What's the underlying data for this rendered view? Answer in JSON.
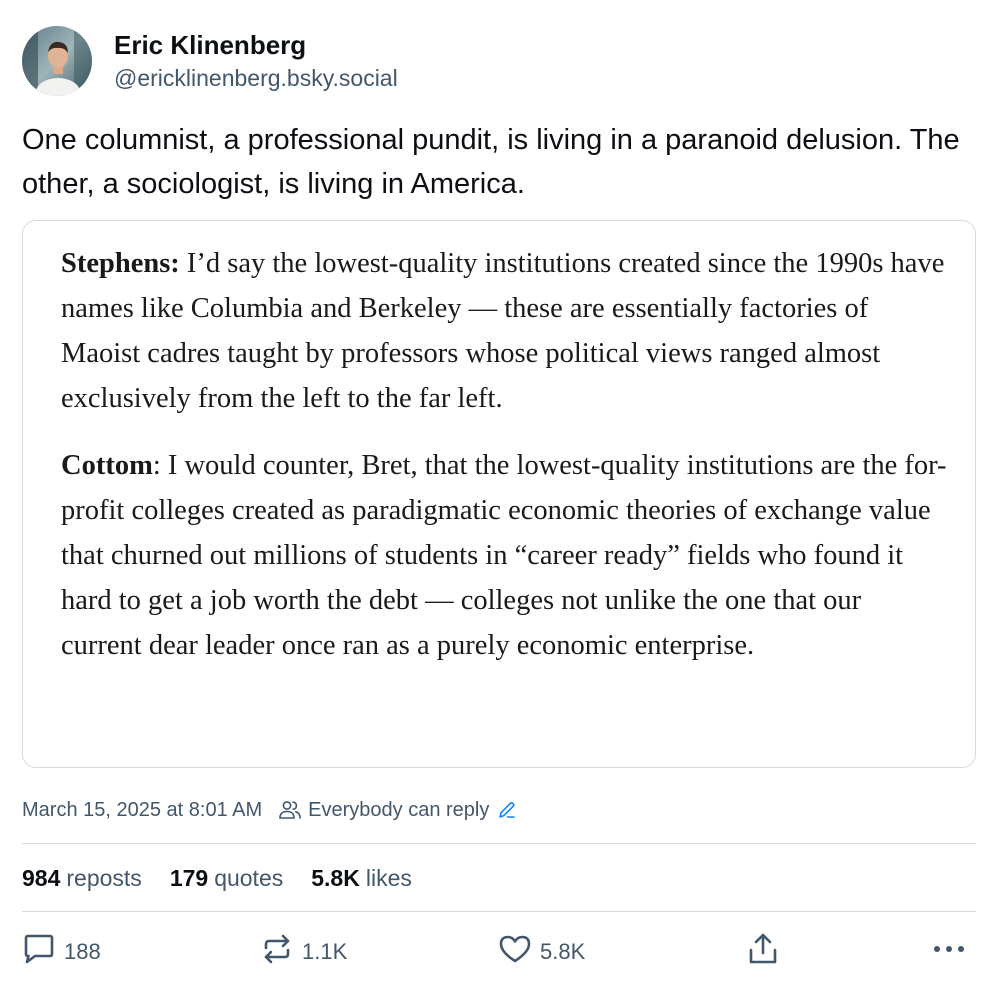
{
  "author": {
    "display_name": "Eric Klinenberg",
    "handle": "@ericklinenberg.bsky.social"
  },
  "post": {
    "text": "One columnist, a professional pundit, is living in a paranoid delusion. The other, a sociologist, is living in America."
  },
  "quote": {
    "paragraphs": [
      {
        "speaker": "Stephens:",
        "text": " I’d say the lowest-quality institutions created since the 1990s have names like Columbia and Berkeley — these are essentially factories of Maoist cadres taught by professors whose political views ranged almost exclusively from the left to the far left."
      },
      {
        "speaker": "Cottom",
        "text": ": I would counter, Bret, that the lowest-quality institutions are the for-profit colleges created as paradigmatic economic theories of exchange value that churned out millions of students in “career ready” fields who found it hard to get a job worth the debt — colleges not unlike the one that our current dear leader once ran as a purely economic enterprise."
      }
    ]
  },
  "meta": {
    "timestamp": "March 15, 2025 at 8:01 AM",
    "reply_setting": "Everybody can reply"
  },
  "stats": {
    "reposts_count": "984",
    "reposts_label": "reposts",
    "quotes_count": "179",
    "quotes_label": "quotes",
    "likes_count": "5.8K",
    "likes_label": "likes"
  },
  "actions": {
    "reply_count": "188",
    "repost_count": "1.1K",
    "like_count": "5.8K"
  },
  "icons": {
    "reply": "speech-bubble-icon",
    "repost": "repost-arrows-icon",
    "like": "heart-icon",
    "share": "share-icon",
    "more": "ellipsis-icon",
    "people": "people-icon",
    "edit": "pencil-icon"
  },
  "colors": {
    "text_primary": "#0b0f14",
    "text_secondary": "#42576c",
    "border": "#d4dbe2"
  }
}
